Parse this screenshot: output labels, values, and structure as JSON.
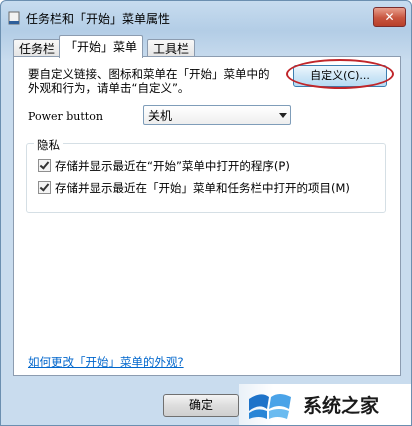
{
  "window": {
    "title": "任务栏和「开始」菜单属性",
    "close_label": "✕"
  },
  "tabs": [
    {
      "label": "任务栏",
      "active": false
    },
    {
      "label": "「开始」菜单",
      "active": true
    },
    {
      "label": "工具栏",
      "active": false
    }
  ],
  "start_menu": {
    "description_line1": "要自定义链接、图标和菜单在「开始」菜单中的",
    "description_line2": "外观和行为，请单击“自定义”。",
    "customize_button": "自定义(C)...",
    "power_label": "Power button",
    "power_value": "关机",
    "privacy_title": "隐私",
    "privacy_options": [
      {
        "label": "存储并显示最近在“开始”菜单中打开的程序(P)",
        "checked": true
      },
      {
        "label": "存储并显示最近在「开始」菜单和任务栏中打开的项目(M)",
        "checked": true
      }
    ],
    "help_link": "如何更改「开始」菜单的外观?"
  },
  "footer": {
    "ok_button": "确定"
  },
  "watermark": {
    "text": "系统之家"
  },
  "colors": {
    "accent_ellipse": "#c0262a",
    "link": "#0066cc",
    "close_button": "#c8553f"
  }
}
